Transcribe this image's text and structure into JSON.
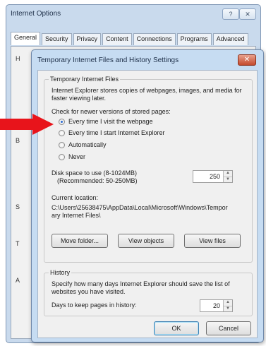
{
  "outer_window": {
    "title": "Internet Options",
    "help_label": "?",
    "close_label": "✕",
    "tabs": [
      {
        "label": "General",
        "active": true
      },
      {
        "label": "Security",
        "active": false
      },
      {
        "label": "Privacy",
        "active": false
      },
      {
        "label": "Content",
        "active": false
      },
      {
        "label": "Connections",
        "active": false
      },
      {
        "label": "Programs",
        "active": false
      },
      {
        "label": "Advanced",
        "active": false
      }
    ],
    "peek_letters": [
      "H",
      "B",
      "S",
      "T",
      "A"
    ]
  },
  "dialog": {
    "title": "Temporary Internet Files and History Settings",
    "close_label": "✕",
    "temp_files": {
      "legend": "Temporary Internet Files",
      "description": "Internet Explorer stores copies of webpages, images, and media for faster viewing later.",
      "check_label": "Check for newer versions of stored pages:",
      "options": [
        {
          "label": "Every time I visit the webpage",
          "checked": true
        },
        {
          "label": "Every time I start Internet Explorer",
          "checked": false
        },
        {
          "label": "Automatically",
          "checked": false
        },
        {
          "label": "Never",
          "checked": false
        }
      ],
      "disk_space_label": "Disk space to use (8-1024MB)",
      "disk_space_recommended": "(Recommended: 50-250MB)",
      "disk_space_value": "250",
      "current_location_label": "Current location:",
      "current_location_path": "C:\\Users\\25638475\\AppData\\Local\\Microsoft\\Windows\\Temporary Internet Files\\",
      "move_folder_button": "Move folder...",
      "view_objects_button": "View objects",
      "view_files_button": "View files"
    },
    "history": {
      "legend": "History",
      "description": "Specify how many days Internet Explorer should save the list of websites you have visited.",
      "days_label": "Days to keep pages in history:",
      "days_value": "20"
    },
    "ok_button": "OK",
    "cancel_button": "Cancel"
  },
  "annotation": {
    "arrow_color": "#e8141b"
  }
}
